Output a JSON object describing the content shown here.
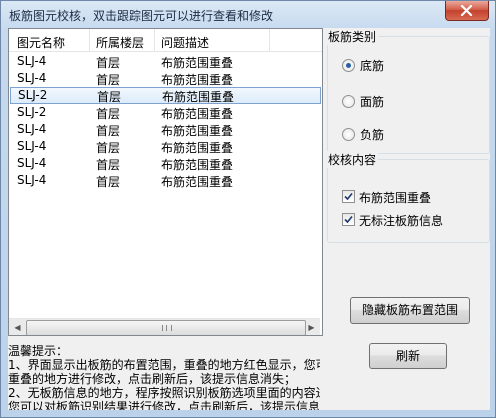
{
  "window": {
    "title": "板筋图元校核，双击跟踪图元可以进行查看和修改"
  },
  "list": {
    "columns": [
      "图元名称",
      "所属楼层",
      "问题描述"
    ],
    "rows": [
      [
        "SLJ-4",
        "首层",
        "布筋范围重叠"
      ],
      [
        "SLJ-4",
        "首层",
        "布筋范围重叠"
      ],
      [
        "SLJ-2",
        "首层",
        "布筋范围重叠"
      ],
      [
        "SLJ-2",
        "首层",
        "布筋范围重叠"
      ],
      [
        "SLJ-4",
        "首层",
        "布筋范围重叠"
      ],
      [
        "SLJ-4",
        "首层",
        "布筋范围重叠"
      ],
      [
        "SLJ-4",
        "首层",
        "布筋范围重叠"
      ],
      [
        "SLJ-4",
        "首层",
        "布筋范围重叠"
      ]
    ],
    "selected_row": 2
  },
  "rebar_type": {
    "title": "板筋类别",
    "options": [
      "底筋",
      "面筋",
      "负筋"
    ],
    "selected": "底筋"
  },
  "check_content": {
    "title": "校核内容",
    "items": [
      {
        "label": "布筋范围重叠",
        "checked": true
      },
      {
        "label": "无标注板筋信息",
        "checked": true
      }
    ]
  },
  "buttons": {
    "hide_range": "隐藏板筋布置范围",
    "refresh": "刷新"
  },
  "tips": {
    "heading": "温馨提示：",
    "lines": [
      "1、界面显示出板筋的布置范围，重叠的地方红色显示，您可",
      "重叠的地方进行修改，点击刷新后，该提示信息消失；",
      "2、无板筋信息的地方，程序按照识别板筋选项里面的内容进",
      "您可以对板筋识别结果进行修改，点击刷新后，该提示信息"
    ]
  }
}
